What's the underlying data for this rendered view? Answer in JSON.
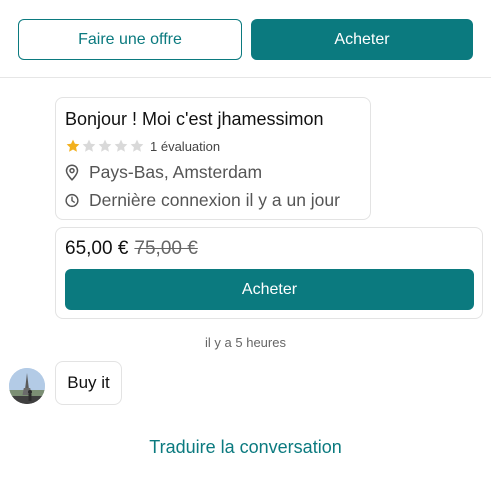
{
  "header": {
    "make_offer_label": "Faire une offre",
    "buy_label": "Acheter"
  },
  "profile": {
    "title": "Bonjour ! Moi c'est jhamessimon",
    "rating": {
      "stars_filled": 1,
      "stars_total": 5,
      "reviews_text": "1 évaluation",
      "star_color": "#f2b01e",
      "empty_star_color": "#d9d9d9"
    },
    "location": "Pays-Bas, Amsterdam",
    "last_seen": "Dernière connexion il y a un jour"
  },
  "offer": {
    "price_new": "65,00 €",
    "price_old": "75,00 €",
    "buy_label": "Acheter"
  },
  "chat": {
    "timestamp": "il y a 5 heures",
    "message": "Buy it"
  },
  "footer": {
    "translate_label": "Traduire la conversation"
  },
  "colors": {
    "accent": "#0b7a7f"
  },
  "icons": {
    "location": "location-pin-icon",
    "clock": "clock-icon"
  }
}
